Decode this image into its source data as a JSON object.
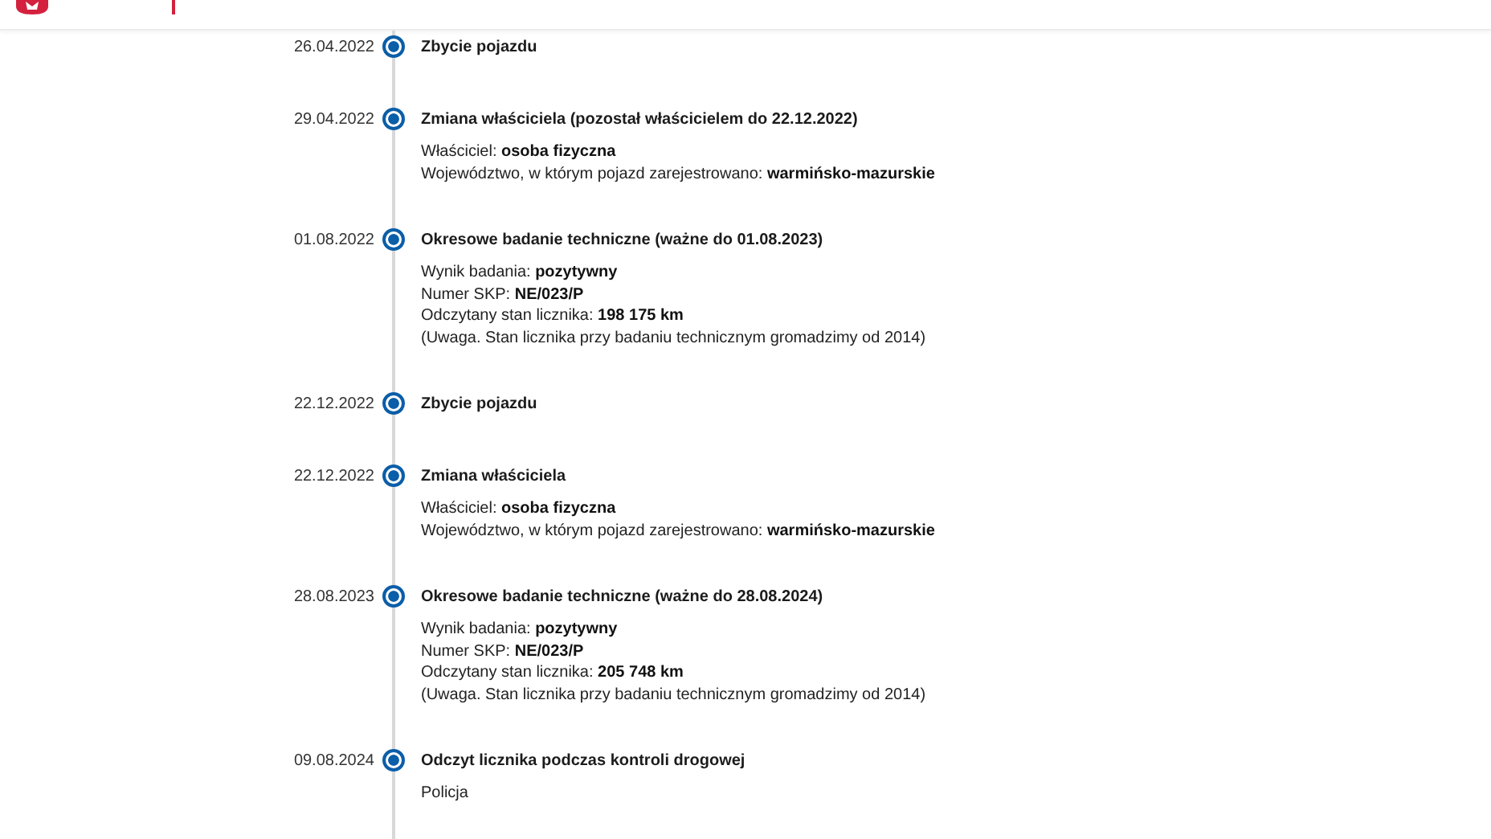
{
  "events": [
    {
      "date": "26.04.2022",
      "title": "Zbycie pojazdu"
    },
    {
      "date": "29.04.2022",
      "title": "Zmiana właściciela (pozostał właścicielem do 22.12.2022)",
      "details": [
        {
          "label": "Właściciel:",
          "value": "osoba fizyczna"
        },
        {
          "label": "Województwo, w którym pojazd zarejestrowano:",
          "value": "warmińsko-mazurskie"
        }
      ]
    },
    {
      "date": "01.08.2022",
      "title": "Okresowe badanie techniczne (ważne do 01.08.2023)",
      "details": [
        {
          "label": "Wynik badania:",
          "value": "pozytywny"
        },
        {
          "label": "Numer SKP:",
          "value": "NE/023/P"
        },
        {
          "label": "Odczytany stan licznika:",
          "value": "198 175 km"
        },
        {
          "label": "(Uwaga. Stan licznika przy badaniu technicznym gromadzimy od 2014)"
        }
      ]
    },
    {
      "date": "22.12.2022",
      "title": "Zbycie pojazdu"
    },
    {
      "date": "22.12.2022",
      "title": "Zmiana właściciela",
      "details": [
        {
          "label": "Właściciel:",
          "value": "osoba fizyczna"
        },
        {
          "label": "Województwo, w którym pojazd zarejestrowano:",
          "value": "warmińsko-mazurskie"
        }
      ]
    },
    {
      "date": "28.08.2023",
      "title": "Okresowe badanie techniczne (ważne do 28.08.2024)",
      "details": [
        {
          "label": "Wynik badania:",
          "value": "pozytywny"
        },
        {
          "label": "Numer SKP:",
          "value": "NE/023/P"
        },
        {
          "label": "Odczytany stan licznika:",
          "value": "205 748 km"
        },
        {
          "label": "(Uwaga. Stan licznika przy badaniu technicznym gromadzimy od 2014)"
        }
      ]
    },
    {
      "date": "09.08.2024",
      "title": "Odczyt licznika podczas kontroli drogowej",
      "details": [
        {
          "label": "Policja"
        }
      ]
    }
  ]
}
